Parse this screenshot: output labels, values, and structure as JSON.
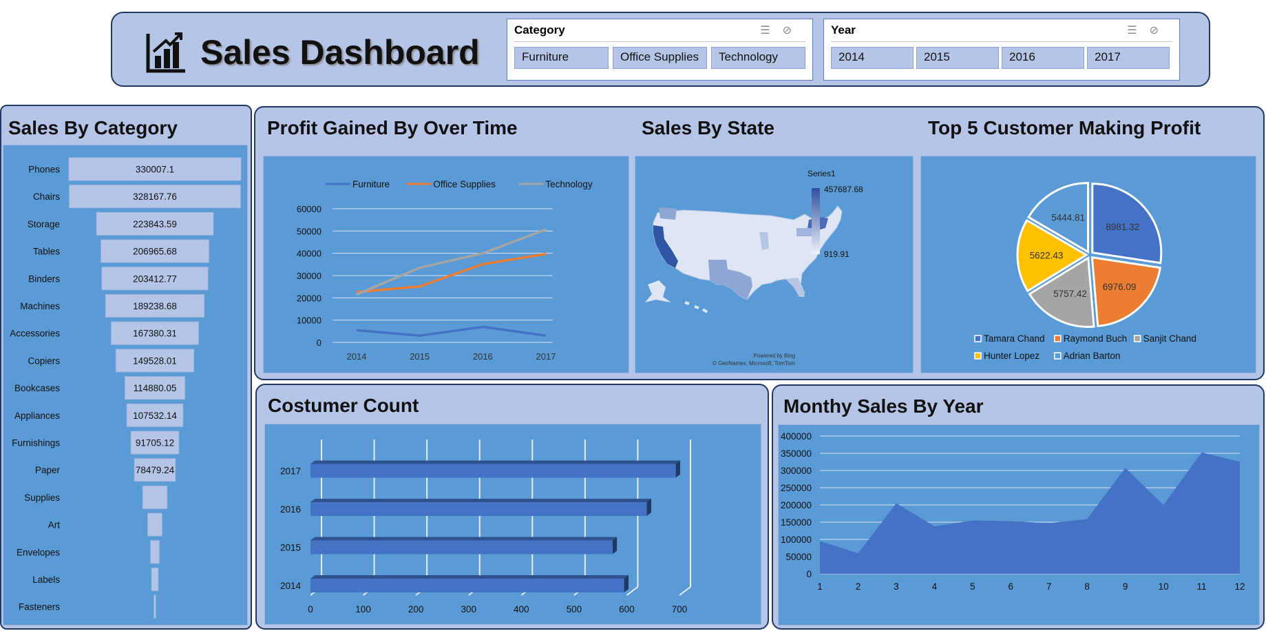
{
  "header": {
    "title": "Sales Dashboard",
    "logo_icon": "bar-chart-icon"
  },
  "slicers": {
    "category": {
      "title": "Category",
      "options": [
        "Furniture",
        "Office Supplies",
        "Technology"
      ]
    },
    "year": {
      "title": "Year",
      "options": [
        "2014",
        "2015",
        "2016",
        "2017"
      ]
    }
  },
  "panels": {
    "sales_by_category": "Sales By Category",
    "profit_over_time": "Profit Gained By Over Time",
    "sales_by_state": "Sales By State",
    "top5": "Top 5 Customer Making Profit",
    "customer_count": "Costumer Count",
    "monthly_sales": "Monthy Sales By Year"
  },
  "map": {
    "legend_title": "Series1",
    "max_label": "457687.68",
    "min_label": "919.91",
    "credit_1": "Powered by Bing",
    "credit_2": "© GeoNames, Microsoft, TomTom"
  },
  "colors": {
    "panel_bg": "#b4c5e7",
    "chart_bg": "#5b9bd5",
    "border": "#1f3864",
    "furniture": "#4472c4",
    "office_supplies": "#ed7d31",
    "technology": "#a5a5a5"
  },
  "chart_data": [
    {
      "id": "sales_by_category",
      "type": "bar",
      "orientation": "funnel",
      "categories": [
        "Phones",
        "Chairs",
        "Storage",
        "Tables",
        "Binders",
        "Machines",
        "Accessories",
        "Copiers",
        "Bookcases",
        "Appliances",
        "Furnishings",
        "Paper",
        "Supplies",
        "Art",
        "Envelopes",
        "Labels",
        "Fasteners"
      ],
      "values": [
        330007.1,
        328167.76,
        223843.59,
        206965.68,
        203412.77,
        189238.68,
        167380.31,
        149528.01,
        114880.05,
        107532.14,
        91705.12,
        78479.24,
        46673.54,
        27118.79,
        16476.4,
        12486.31,
        3024.28
      ],
      "labels": [
        "330007.1",
        "328167.76",
        "223843.59",
        "206965.68",
        "203412.77",
        "189238.68",
        "167380.31",
        "149528.01",
        "114880.05",
        "107532.14",
        "91705.12",
        "78479.24",
        "",
        "",
        "",
        "",
        ""
      ]
    },
    {
      "id": "profit_over_time",
      "type": "line",
      "x": [
        "2014",
        "2015",
        "2016",
        "2017"
      ],
      "series": [
        {
          "name": "Furniture",
          "color": "#4472c4",
          "values": [
            5450,
            3020,
            6960,
            3020
          ]
        },
        {
          "name": "Office Supplies",
          "color": "#ed7d31",
          "values": [
            22600,
            25100,
            35100,
            39700
          ]
        },
        {
          "name": "Technology",
          "color": "#a5a5a5",
          "values": [
            21500,
            33500,
            40000,
            50700
          ]
        }
      ],
      "ylim": [
        0,
        60000
      ],
      "yticks": [
        0,
        10000,
        20000,
        30000,
        40000,
        50000,
        60000
      ]
    },
    {
      "id": "top5",
      "type": "pie",
      "categories": [
        "Tamara Chand",
        "Raymond Buch",
        "Sanjit Chand",
        "Hunter Lopez",
        "Adrian Barton"
      ],
      "values": [
        8981.32,
        6976.09,
        5757.42,
        5622.43,
        5444.81
      ],
      "colors": [
        "#4472c4",
        "#ed7d31",
        "#a5a5a5",
        "#ffc000",
        "#5b9bd5"
      ],
      "legend": "bottom"
    },
    {
      "id": "customer_count",
      "type": "bar",
      "orientation": "horizontal",
      "categories": [
        "2014",
        "2015",
        "2016",
        "2017"
      ],
      "values": [
        595,
        573,
        638,
        693
      ],
      "xlim": [
        0,
        700
      ],
      "xticks": [
        0,
        100,
        200,
        300,
        400,
        500,
        600,
        700
      ],
      "grid": true
    },
    {
      "id": "monthly_sales",
      "type": "area",
      "x": [
        1,
        2,
        3,
        4,
        5,
        6,
        7,
        8,
        9,
        10,
        11,
        12
      ],
      "values": [
        94925,
        59751,
        205005,
        137762,
        155029,
        152718,
        147238,
        159044,
        307650,
        200323,
        352461,
        325293
      ],
      "ylim": [
        0,
        400000
      ],
      "yticks": [
        0,
        50000,
        100000,
        150000,
        200000,
        250000,
        300000,
        350000,
        400000
      ],
      "grid": true
    }
  ]
}
